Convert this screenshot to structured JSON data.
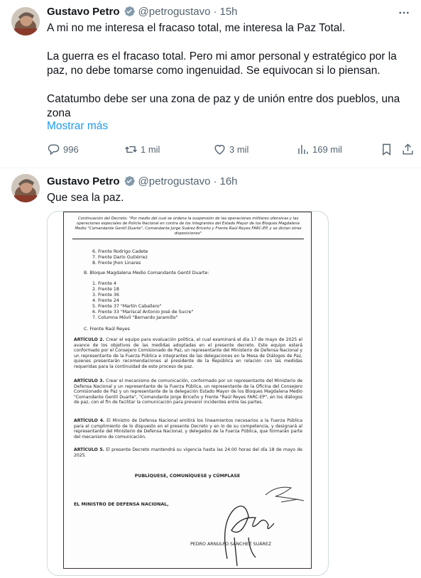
{
  "tweets": [
    {
      "name": "Gustavo Petro",
      "handle": "@petrogustavo",
      "time": "15h",
      "text_lines": [
        "A mi no me interesa el fracaso total, me interesa la Paz Total.",
        "La guerra es el fracaso total. Pero mi amor personal y estratégico por la paz, no debe tomarse como ingenuidad. Se equivocan si lo piensan.",
        "Catatumbo debe ser una zona de paz y de unión entre dos pueblos, una zona"
      ],
      "show_more": "Mostrar más",
      "replies": "996",
      "reposts": "1 mil",
      "likes": "3 mil",
      "views": "169 mil"
    },
    {
      "name": "Gustavo Petro",
      "handle": "@petrogustavo",
      "time": "16h",
      "text": "Que sea la paz."
    }
  ],
  "document": {
    "header": "Continuación del Decreto: \"Por medio del cual se ordena la suspensión de las operaciones militares ofensivas y las operaciones especiales de Policía Nacional en contra de los integrantes del Estado Mayor de los Bloques Magdalena Medio \"Comandante Gentil Duarte\", Comandante Jorge Suárez Briceño y Frente Raúl Reyes FARC-EP, y se dictan otras disposiciones\"",
    "list_a": [
      "6.   Frente Rodrigo Cadete",
      "7.   Frente Darío Gutiérrez",
      "8.   Frente Jhon Linares"
    ],
    "section_b": "B.   Bloque Magdalena Medio Comandante Gentil Duarte:",
    "list_b": [
      "1.   Frente 4",
      "2.   Frente 18",
      "3.   Frente 36",
      "4.   Frente 24",
      "5.   Frente 37 \"Martín Caballero\"",
      "6.   Frente 33 \"Mariscal Antonio José de Sucre\"",
      "7.   Columna Móvil \"Bernardo Jaramillo\""
    ],
    "section_c": "C.   Frente Raúl Reyes",
    "art2_title": "ARTÍCULO 2.",
    "art2": " Crear el equipo para evaluación política, el cual examinará el día 17 de mayo de 2025 el avance de los objetivos de las medidas adoptadas en el presente decreto. Este equipo estará conformado por el Consejero Comisionado de Paz, un representante del Ministerio de Defensa Nacional y un representante de la Fuerza Pública e integrantes de las delegaciones en la Mesa de Diálogos de Paz, quienes presentarán recomendaciones al presidente de la República en relación con las medidas requeridas para la continuidad de este proceso de paz.",
    "art3_title": "ARTÍCULO 3.",
    "art3": " Crear el mecanismo de comunicación, conformado por un representante del Ministerio de Defensa Nacional y un representante de la Fuerza Pública, un representante de la Oficina del Consejero Comisionado de Paz y un representante de la delegación Estado Mayor de los Bloques Magdalena Medio \"Comandante Gentil Duarte\", \"Comandante Jorge Briceño y Frente \"Raúl Reyes FARC-EP\", en los diálogos de paz, con el fin de facilitar la comunicación para prevenir incidentes entre las partes.",
    "art4_title": "ARTÍCULO 4.",
    "art4": " El Ministro de Defensa Nacional emitirá los lineamientos necesarios a la Fuerza Pública para el cumplimiento de lo dispuesto en el presente Decreto y en lo de su competencia, y designará al representante del Ministerio de Defensa Nacional, y delegados de la Fuerza Pública, que formarán parte del mecanismo de comunicación.",
    "art5_title": "ARTÍCULO 5.",
    "art5": " El presente Decreto mantendrá su vigencia hasta las 24:00 horas del día 18 de mayo de 2025.",
    "publish": "PUBLÍQUESE, COMUNÍQUESE y CÚMPLASE",
    "minister": "EL MINISTRO DE DEFENSA NACIONAL,",
    "signer": "PEDRO ARNULFO SÁNCHEZ SUÁREZ"
  }
}
